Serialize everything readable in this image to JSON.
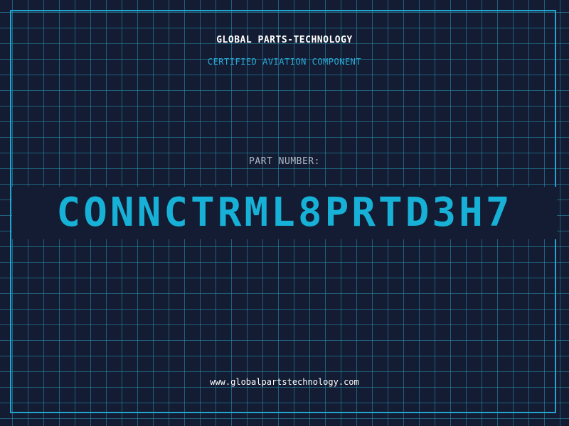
{
  "header": {
    "company": "GLOBAL PARTS-TECHNOLOGY",
    "subtitle": "CERTIFIED AVIATION COMPONENT"
  },
  "part": {
    "label": "PART NUMBER:",
    "number": "CONNCTRML8PRTD3H7"
  },
  "footer": {
    "url": "www.globalpartstechnology.com"
  },
  "colors": {
    "background": "#131c32",
    "grid": "#2896b4",
    "accent": "#22a6cf",
    "part_number": "#17b0d6"
  }
}
